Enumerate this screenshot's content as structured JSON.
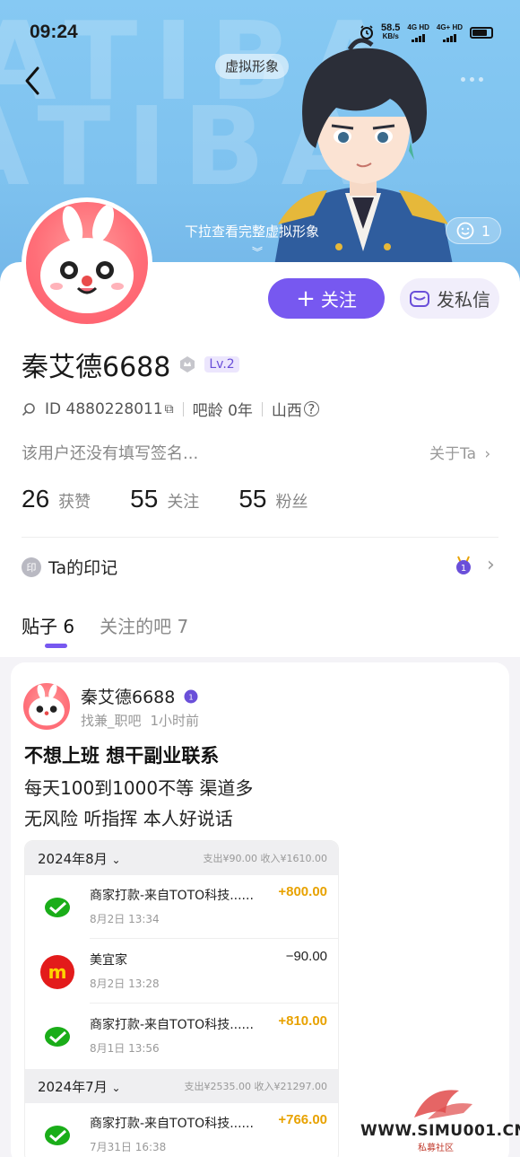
{
  "status_bar": {
    "time": "09:24",
    "speed_value": "58.5",
    "speed_unit": "KB/s",
    "net1": "4G HD",
    "net2": "4G+ HD"
  },
  "header": {
    "virtual_tag": "虚拟形象",
    "pull_hint": "下拉查看完整虚拟形象",
    "like_count": "1"
  },
  "profile": {
    "follow_label": "关注",
    "message_label": "发私信",
    "username": "秦艾德6688",
    "level": "Lv.2",
    "id_label": "ID 4880228011",
    "bar_age": "吧龄 0年",
    "location": "山西",
    "signature": "该用户还没有填写签名...",
    "about_label": "关于Ta",
    "stats": [
      {
        "num": "26",
        "label": "获赞"
      },
      {
        "num": "55",
        "label": "关注"
      },
      {
        "num": "55",
        "label": "粉丝"
      }
    ],
    "marks_badge": "印",
    "marks_label": "Ta的印记"
  },
  "tabs": [
    {
      "label": "贴子 6",
      "active": true
    },
    {
      "label": "关注的吧 7",
      "active": false
    }
  ],
  "post": {
    "author": "秦艾德6688",
    "forum": "找兼_职吧",
    "time": "1小时前",
    "title": "不想上班 想干副业联系",
    "lines": [
      "每天100到1000不等 渠道多",
      "无风险 听指挥 本人好说话"
    ],
    "receipt": {
      "months": [
        {
          "month": "2024年8月",
          "summary": "支出¥90.00 收入¥1610.00"
        },
        {
          "month": "2024年7月",
          "summary": "支出¥2535.00 收入¥21297.00"
        }
      ],
      "transactions": [
        {
          "name": "商家打款-来自TOTO科技......",
          "date": "8月2日 13:34",
          "amount": "+800.00",
          "type": "in",
          "icon": "wechat-pay-icon"
        },
        {
          "name": "美宜家",
          "date": "8月2日 13:28",
          "amount": "−90.00",
          "type": "out",
          "icon": "meiyijia-logo"
        },
        {
          "name": "商家打款-来自TOTO科技......",
          "date": "8月1日 13:56",
          "amount": "+810.00",
          "type": "in",
          "icon": "wechat-pay-icon"
        },
        {
          "name": "商家打款-来自TOTO科技......",
          "date": "7月31日 16:38",
          "amount": "+766.00",
          "type": "in",
          "icon": "wechat-pay-icon"
        }
      ]
    }
  },
  "watermark": {
    "url": "WWW.SIMU001.CN",
    "cn": "私募社区"
  }
}
